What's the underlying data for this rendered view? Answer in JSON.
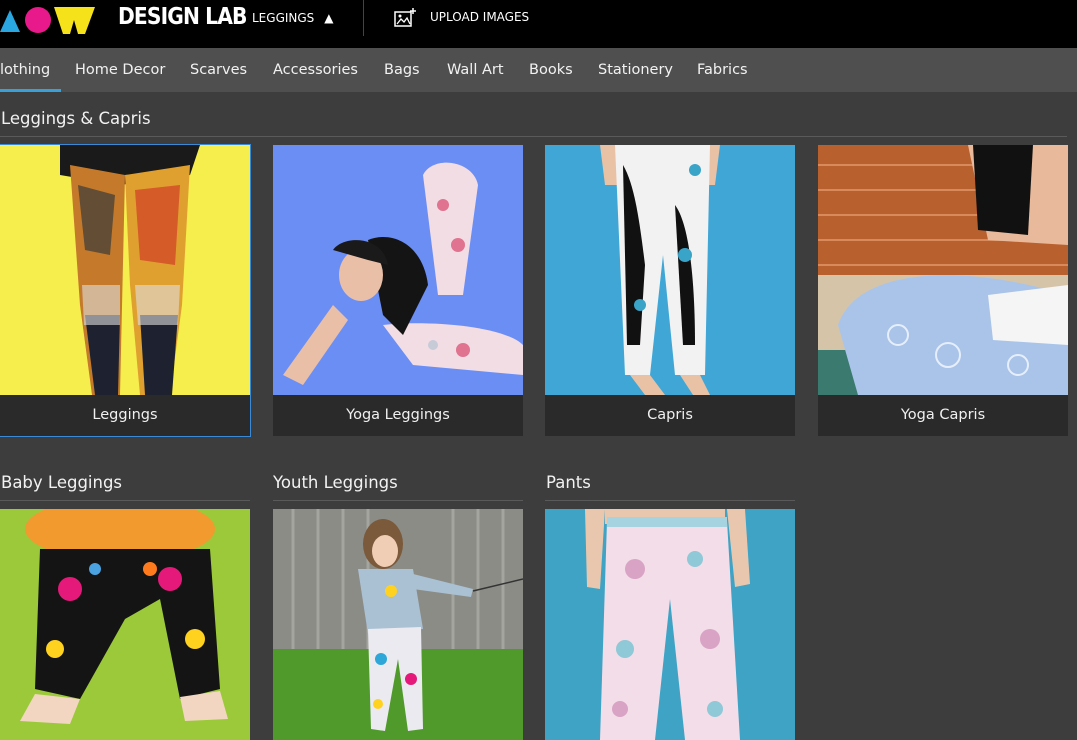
{
  "header": {
    "brand": "DESIGN LAB",
    "product_selector": "LEGGINGS",
    "product_caret": "▲",
    "upload_label": "UPLOAD IMAGES"
  },
  "category_tabs": [
    {
      "label": "lothing"
    },
    {
      "label": "Home Decor"
    },
    {
      "label": "Scarves"
    },
    {
      "label": "Accessories"
    },
    {
      "label": "Bags"
    },
    {
      "label": "Wall Art"
    },
    {
      "label": "Books"
    },
    {
      "label": "Stationery"
    },
    {
      "label": "Fabrics"
    }
  ],
  "sections": [
    {
      "title": "Leggings & Capris",
      "products": [
        {
          "label": "Leggings"
        },
        {
          "label": "Yoga Leggings"
        },
        {
          "label": "Capris"
        },
        {
          "label": "Yoga Capris"
        }
      ]
    },
    {
      "title": "Baby Leggings"
    },
    {
      "title": "Youth Leggings"
    },
    {
      "title": "Pants"
    }
  ],
  "colors": {
    "accent": "#3a8ad8",
    "background": "#3d3d3d",
    "nav_bar": "#4f4f4f",
    "top_bar": "#000000"
  }
}
